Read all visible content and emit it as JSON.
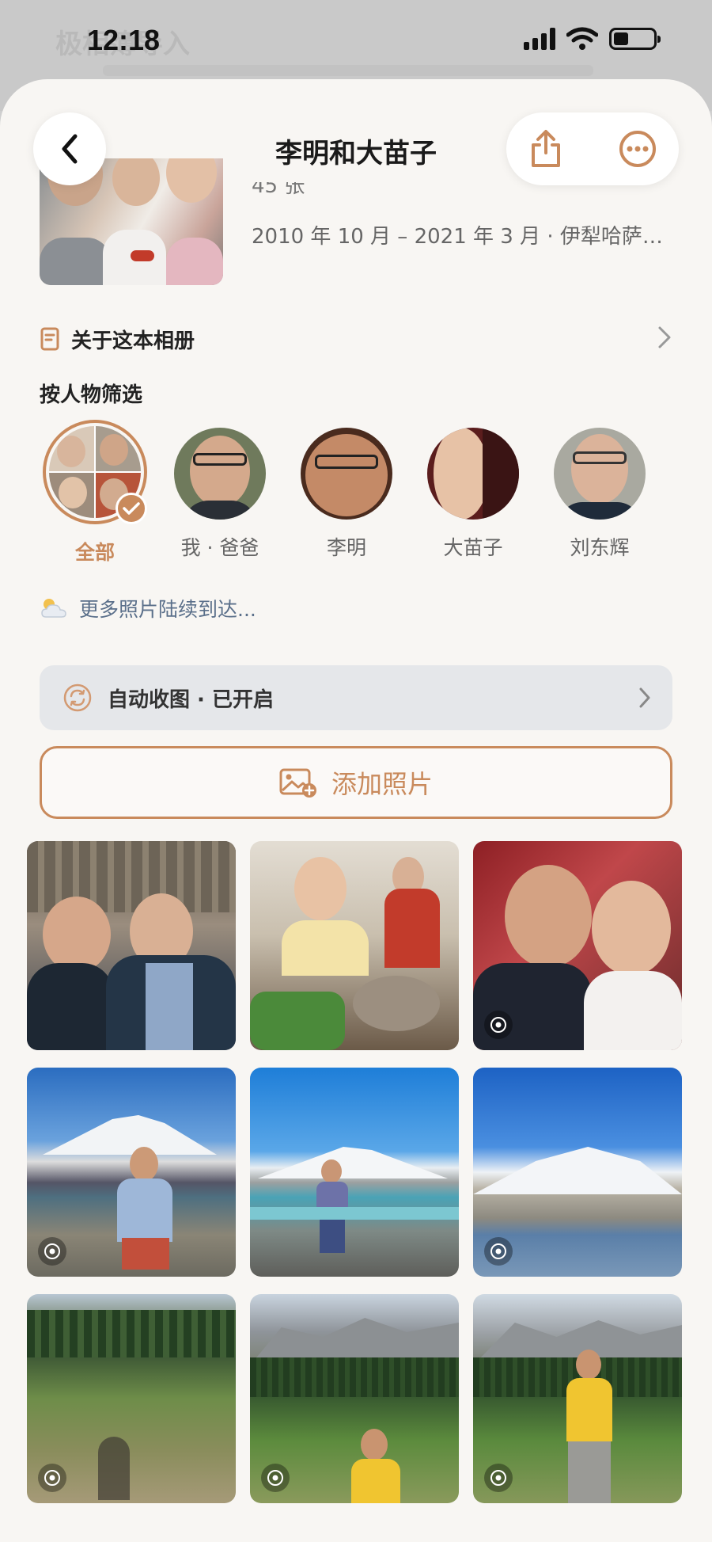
{
  "background": {
    "text": "极相簿导入"
  },
  "status_bar": {
    "time": "12:18"
  },
  "nav": {
    "title": "李明和大苗子"
  },
  "album": {
    "photo_count": "45 张",
    "date_range": "2010 年 10 月 – 2021 年 3 月 · 伊犁哈萨克..."
  },
  "about": {
    "label": "关于这本相册"
  },
  "filter": {
    "title": "按人物筛选",
    "people": [
      {
        "name": "全部",
        "selected": true
      },
      {
        "name": "我 · 爸爸",
        "selected": false
      },
      {
        "name": "李明",
        "selected": false
      },
      {
        "name": "大苗子",
        "selected": false
      },
      {
        "name": "刘东辉",
        "selected": false
      }
    ]
  },
  "more_photos": {
    "text": "更多照片陆续到达..."
  },
  "auto_collect": {
    "label": "自动收图 · 已开启"
  },
  "add_photos": {
    "label": "添加照片"
  },
  "colors": {
    "accent": "#c98a5c",
    "sheet_bg": "#f8f6f3",
    "link": "#5a6f8a"
  },
  "photos": [
    {
      "scene": "restaurant-selfie",
      "live": false
    },
    {
      "scene": "hotpot-kitchen",
      "live": false
    },
    {
      "scene": "couch-selfie",
      "live": true
    },
    {
      "scene": "lake-mountain-man",
      "live": true
    },
    {
      "scene": "lake-road-man",
      "live": false
    },
    {
      "scene": "lake-mountain",
      "live": true
    },
    {
      "scene": "grassland",
      "live": true
    },
    {
      "scene": "mountain-meadow-man",
      "live": true
    },
    {
      "scene": "mountain-meadow-man-2",
      "live": true
    }
  ]
}
